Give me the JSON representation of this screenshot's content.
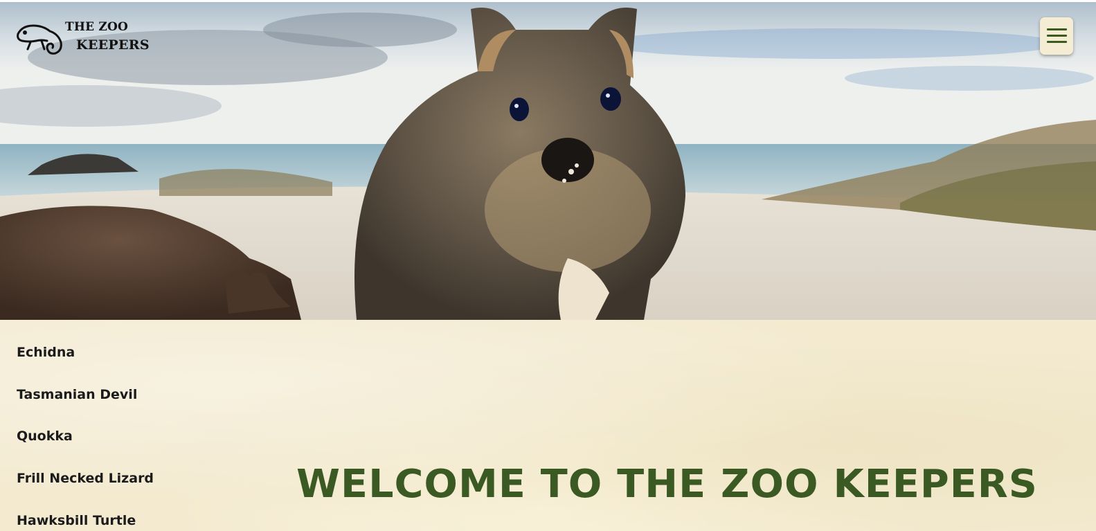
{
  "site": {
    "logo_line1": "THE ZOO",
    "logo_line2": "KEEPERS",
    "logo_icon": "chameleon-icon",
    "menu_icon": "hamburger-menu-icon"
  },
  "hero": {
    "image": "quokka-on-beach-photo"
  },
  "sidebar": {
    "items": [
      {
        "label": "Echidna"
      },
      {
        "label": "Tasmanian Devil"
      },
      {
        "label": "Quokka"
      },
      {
        "label": "Frill Necked Lizard"
      },
      {
        "label": "Hawksbill Turtle"
      }
    ]
  },
  "main": {
    "heading": "WELCOME TO THE ZOO KEEPERS"
  },
  "colors": {
    "accent_green": "#3b5a23",
    "background_cream": "#f3ead0"
  }
}
